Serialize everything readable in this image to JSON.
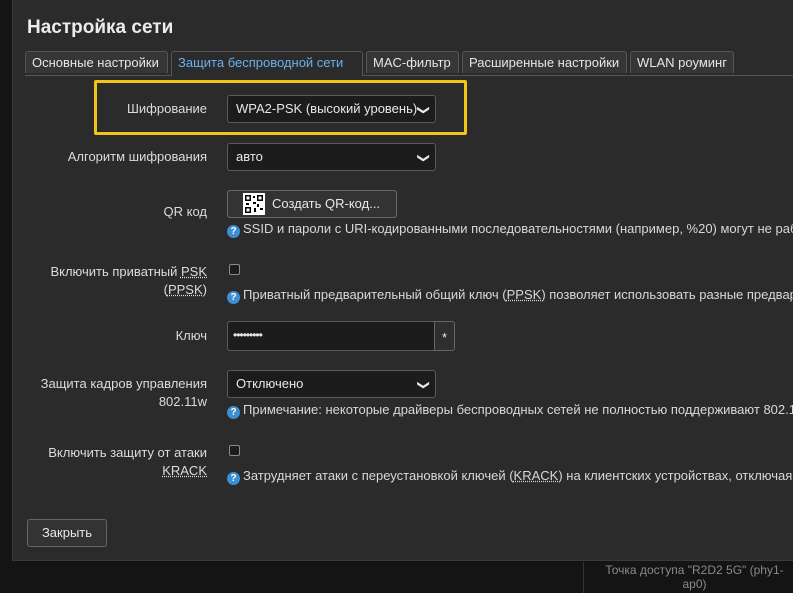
{
  "dialog": {
    "title": "Настройка сети",
    "close_label": "Закрыть"
  },
  "tabs": [
    {
      "label": "Основные настройки",
      "active": false
    },
    {
      "label": "Защита беспроводной сети",
      "active": true
    },
    {
      "label": "MAC-фильтр",
      "active": false
    },
    {
      "label": "Расширенные настройки",
      "active": false
    },
    {
      "label": "WLAN роуминг",
      "active": false
    }
  ],
  "fields": {
    "encryption": {
      "label": "Шифрование",
      "value": "WPA2-PSK (высокий уровень)"
    },
    "cipher": {
      "label": "Алгоритм шифрования",
      "value": "авто"
    },
    "qr": {
      "label": "QR код",
      "button_label": "Создать QR-код...",
      "hint": "SSID и пароли с URI-кодированными последовательностями (например, %20) могут не раб"
    },
    "ppsk": {
      "label_prefix": "Включить приватный ",
      "label_abbr1": "PSK",
      "label_abbr2": "PPSK",
      "label_open": "(",
      "label_close": ")",
      "hint_prefix": "Приватный предварительный общий ключ (",
      "hint_abbr": "PPSK",
      "hint_suffix": ") позволяет использовать разные предвар"
    },
    "key": {
      "label": "Ключ",
      "value": "•••••••••",
      "reveal_label": "*"
    },
    "mgmt_frame": {
      "label_line1": "Защита кадров управления",
      "label_line2": "802.11w",
      "value": "Отключено",
      "hint": "Примечание: некоторые драйверы беспроводных сетей не полностью поддерживают 802.1"
    },
    "krack": {
      "label_line1": "Включить защиту от атаки",
      "label_line2": "KRACK",
      "hint_prefix": "Затрудняет атаки с переустановкой ключей (",
      "hint_abbr": "KRACK",
      "hint_suffix": ") на клиентских устройствах, отключая"
    }
  },
  "background": {
    "ap_text": "Точка доступа \"R2D2 5G\" (phy1-ap0)"
  },
  "icons": {
    "help": "?",
    "chevron": "❯"
  },
  "colors": {
    "accent": "#6ab0ee",
    "highlight": "#f2c418",
    "help_icon": "#3c8fd0"
  }
}
